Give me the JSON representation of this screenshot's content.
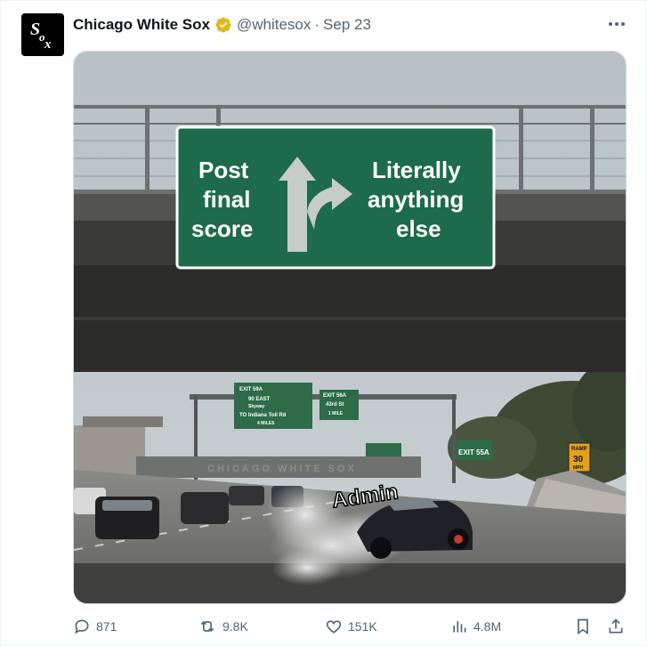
{
  "tweet": {
    "author_name": "Chicago White Sox",
    "handle": "@whitesox",
    "separator": "·",
    "date": "Sep 23",
    "avatar_text": "Sox"
  },
  "image": {
    "sign_left": [
      "Post",
      "final",
      "score"
    ],
    "sign_right": [
      "Literally",
      "anything",
      "else"
    ],
    "car_label": "Admin",
    "bg_sign_1": [
      "EXIT 59A",
      "90 EAST",
      "Skyway",
      "TO Indiana Toll Rd",
      "4 MILES"
    ],
    "bg_sign_2": [
      "EXIT 56A",
      "43rd St",
      "1 MILE"
    ],
    "bg_sign_3": "EXIT 55A",
    "ramp_sign": [
      "RAMP",
      "30",
      "MPH"
    ],
    "overpass_text": "CHICAGO WHITE SOX"
  },
  "actions": {
    "replies": "871",
    "reposts": "9.8K",
    "likes": "151K",
    "views": "4.8M"
  },
  "colors": {
    "sign_green": "#1d6b4a",
    "verified_gold": "#e2b719",
    "muted_text": "#536471"
  }
}
